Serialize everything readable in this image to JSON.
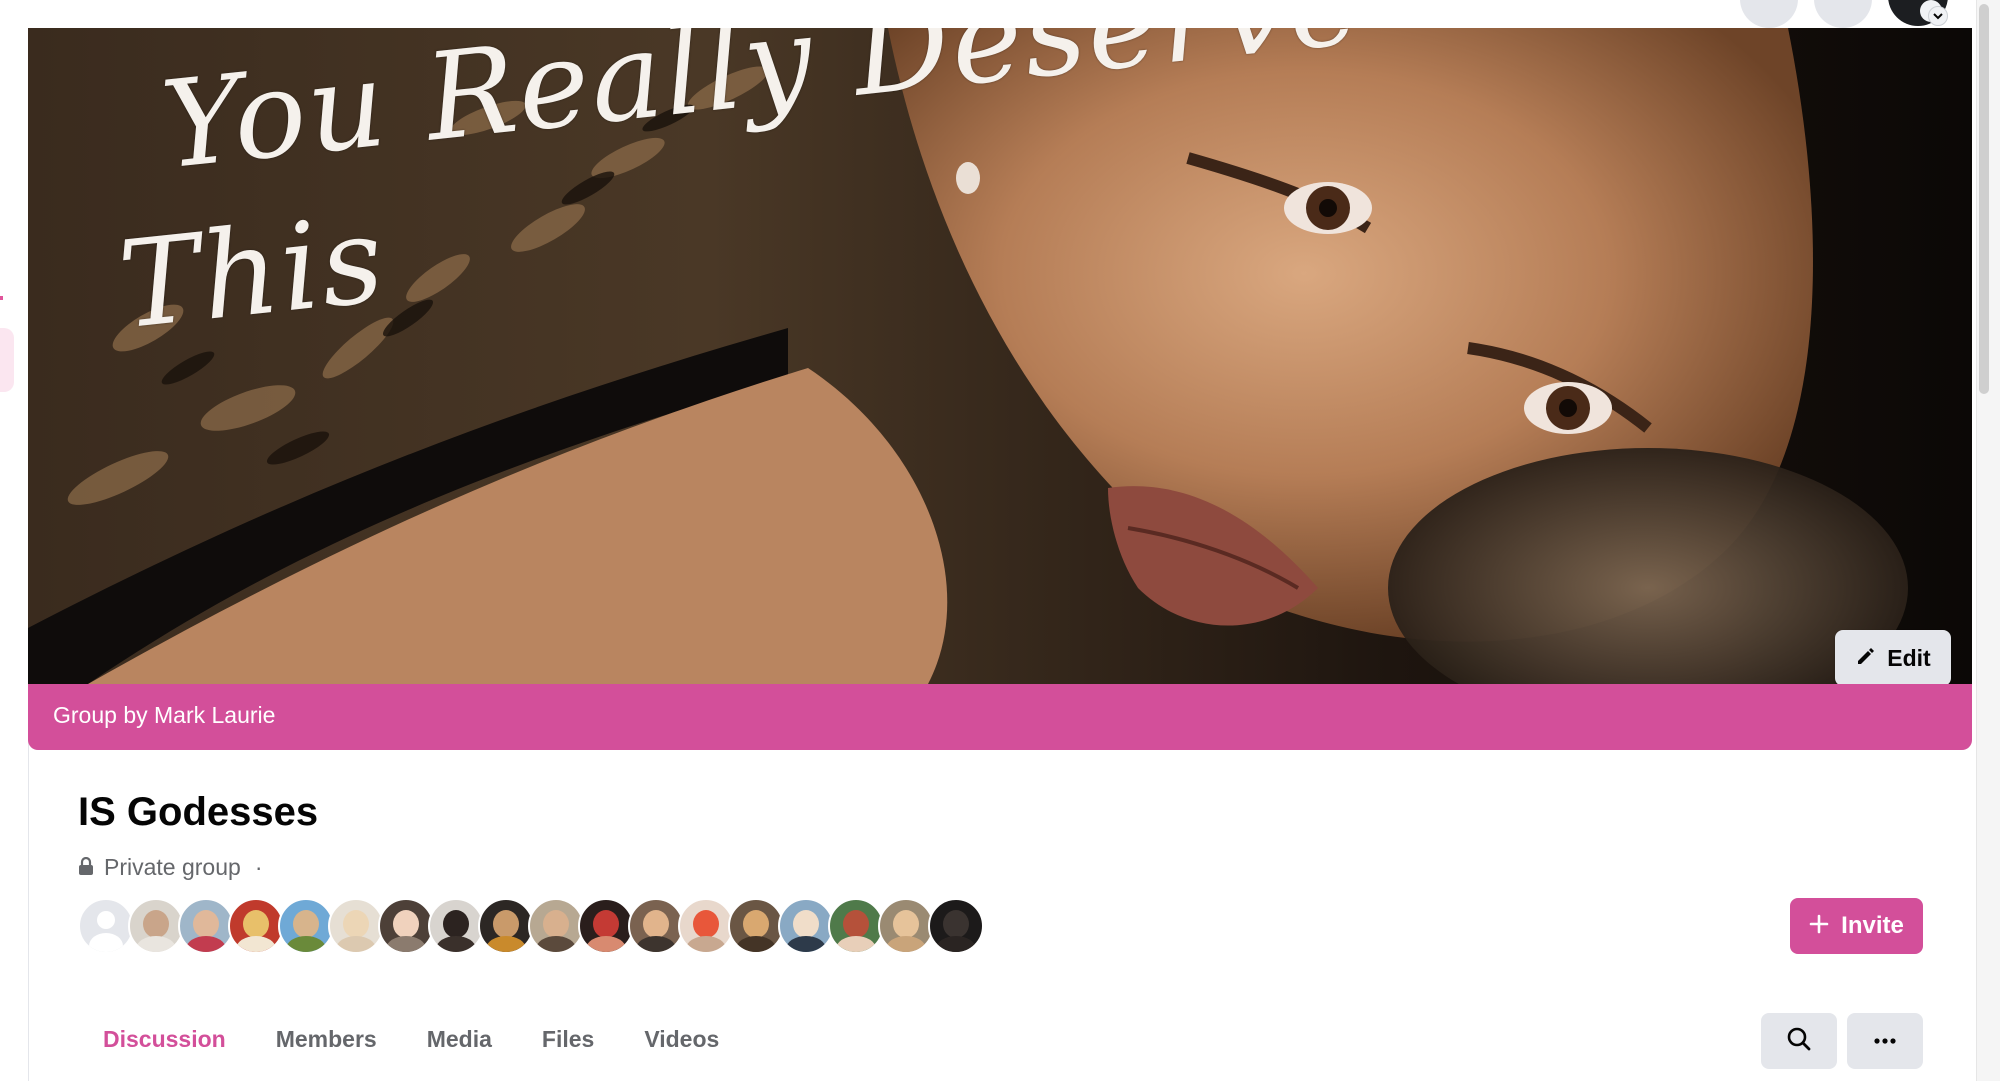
{
  "cover": {
    "script_line1": "You Really Deserve",
    "script_line2": "This"
  },
  "edit_label": "Edit",
  "group_by": "Group by Mark Laurie",
  "group": {
    "name": "IS Godesses",
    "privacy": "Private group",
    "separator": "·"
  },
  "invite_label": "Invite",
  "tabs": [
    {
      "label": "Discussion",
      "active": true
    },
    {
      "label": "Members",
      "active": false
    },
    {
      "label": "Media",
      "active": false
    },
    {
      "label": "Files",
      "active": false
    },
    {
      "label": "Videos",
      "active": false
    }
  ],
  "colors": {
    "brand": "#d34f9a",
    "button_gray": "#e4e6eb",
    "text_secondary": "#65676b"
  },
  "icons": [
    "pencil-icon",
    "lock-icon",
    "plus-icon",
    "search-icon",
    "more-icon",
    "chevron-down-icon",
    "default-avatar-icon"
  ],
  "member_avatar_count": 18
}
